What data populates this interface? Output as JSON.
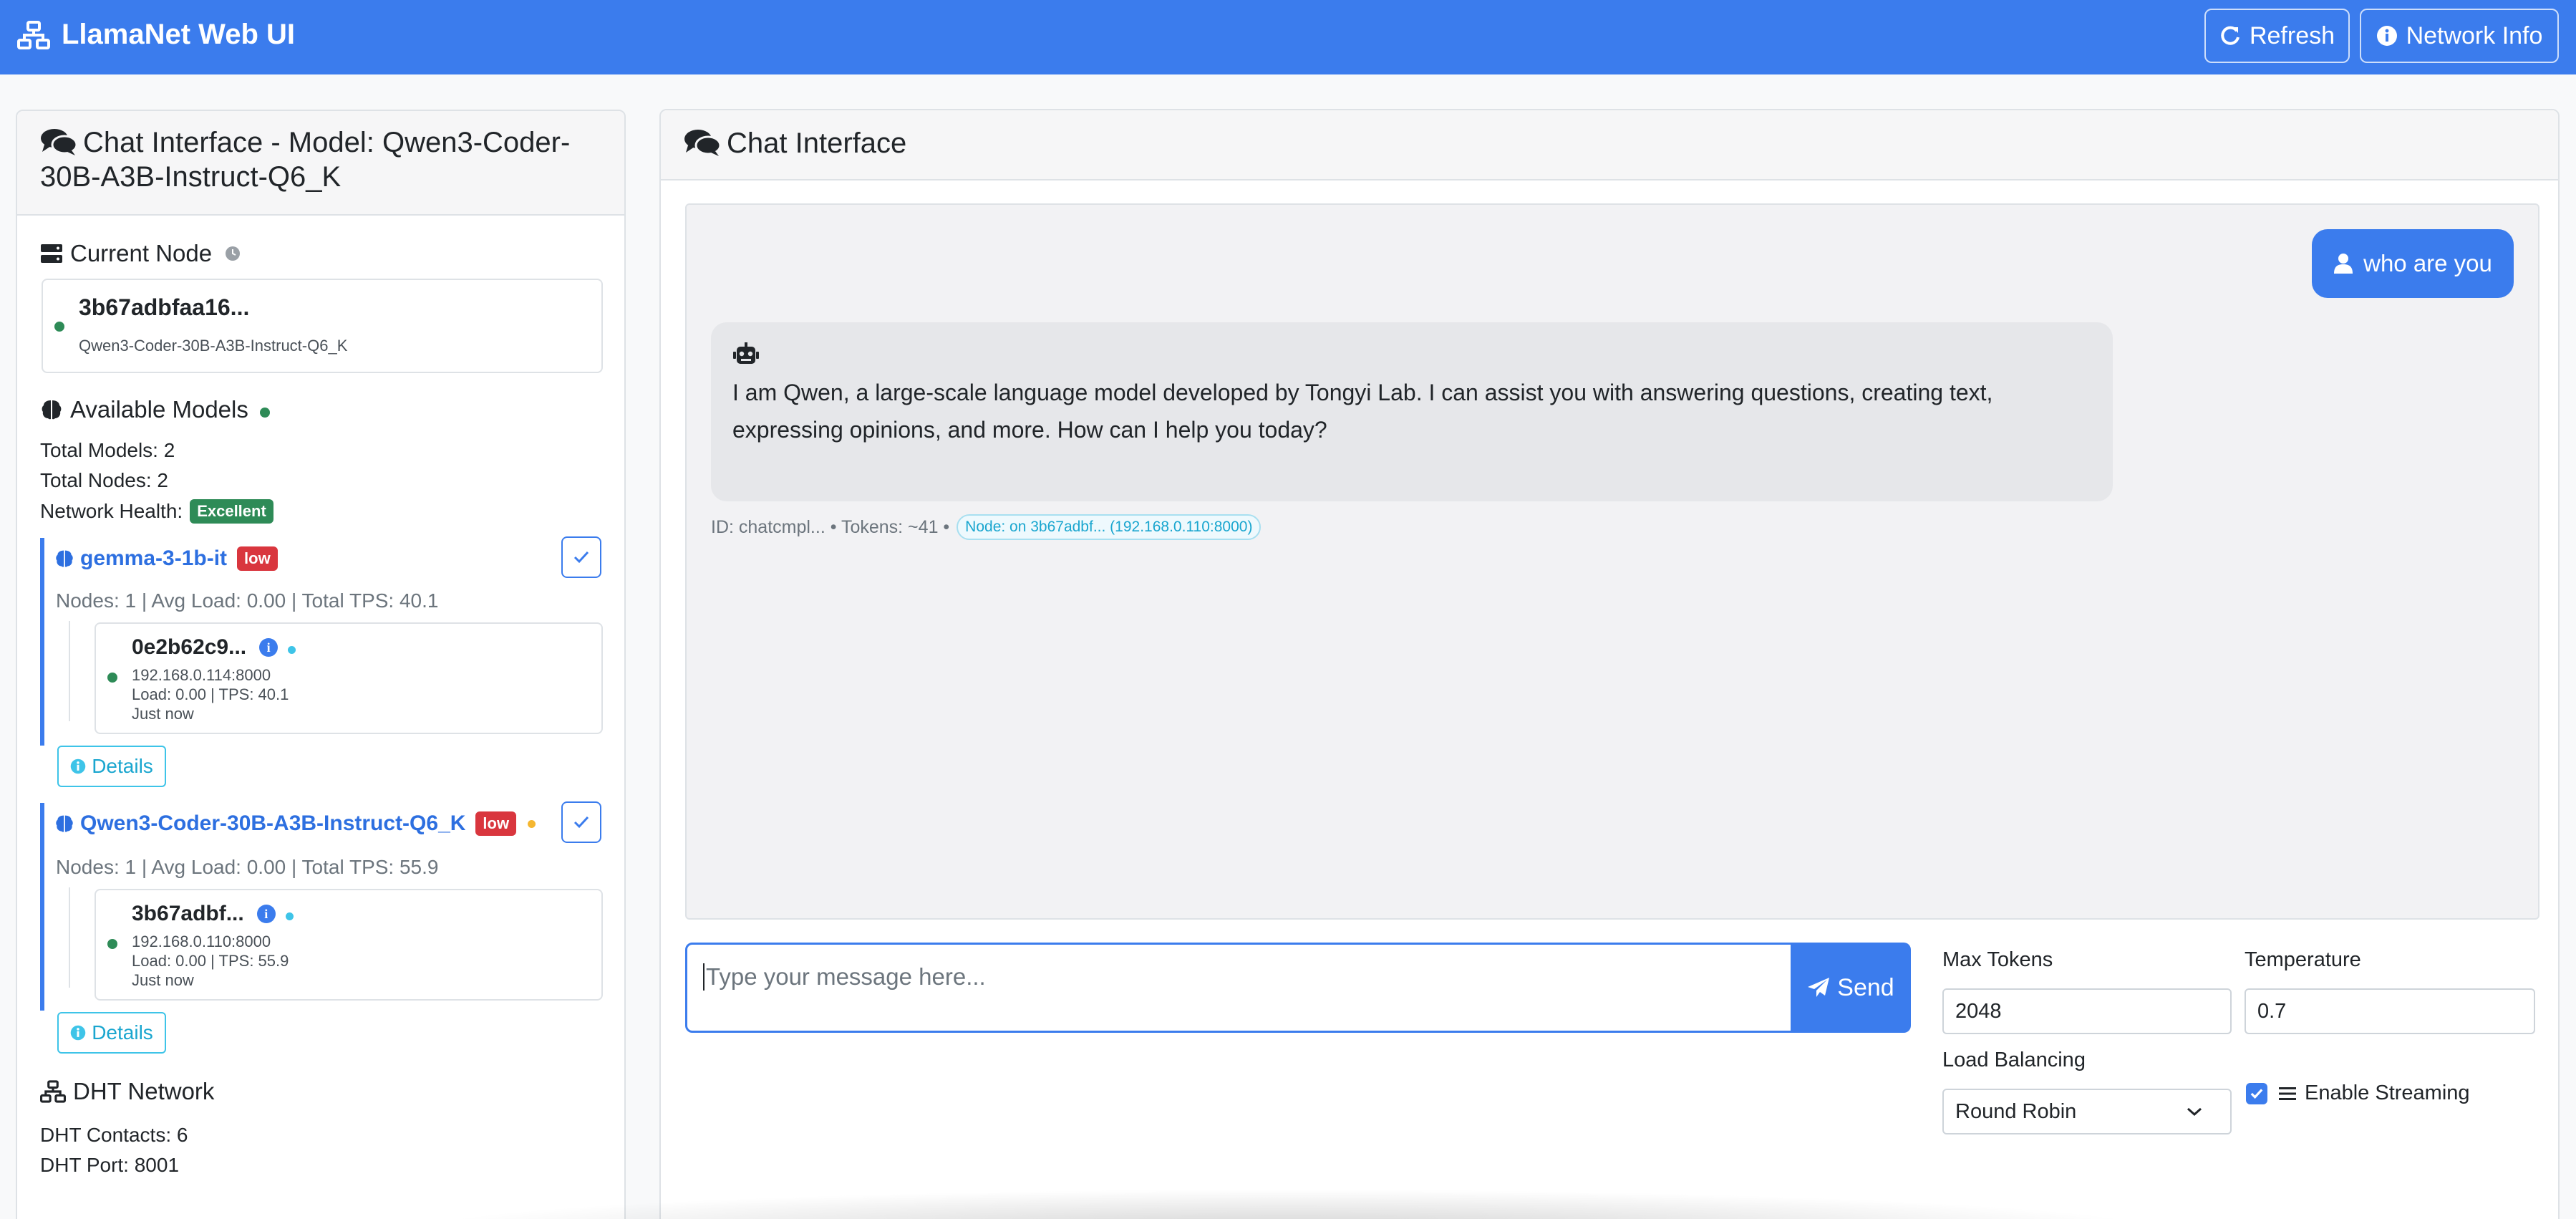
{
  "navbar": {
    "brand": "LlamaNet Web UI",
    "refresh_label": "Refresh",
    "network_info_label": "Network Info"
  },
  "sidebar": {
    "title": "Chat Interface - Model: Qwen3-Coder-30B-A3B-Instruct-Q6_K",
    "current_node": {
      "heading": "Current Node",
      "node_id": "3b67adbfaa16...",
      "model": "Qwen3-Coder-30B-A3B-Instruct-Q6_K"
    },
    "available_models": {
      "heading": "Available Models",
      "total_models": "Total Models: 2",
      "total_nodes": "Total Nodes: 2",
      "network_health_label": "Network Health:",
      "network_health_value": "Excellent"
    },
    "models": [
      {
        "name": "gemma-3-1b-it",
        "badge": "low",
        "stats": "Nodes: 1 | Avg Load: 0.00 | Total TPS: 40.1",
        "node": {
          "id": "0e2b62c9...",
          "address": "192.168.0.114:8000",
          "load": "Load: 0.00 | TPS: 40.1",
          "seen": "Just now"
        },
        "details_label": "Details"
      },
      {
        "name": "Qwen3-Coder-30B-A3B-Instruct-Q6_K",
        "badge": "low",
        "stats": "Nodes: 1 | Avg Load: 0.00 | Total TPS: 55.9",
        "node": {
          "id": "3b67adbf...",
          "address": "192.168.0.110:8000",
          "load": "Load: 0.00 | TPS: 55.9",
          "seen": "Just now"
        },
        "details_label": "Details"
      }
    ],
    "dht": {
      "heading": "DHT Network",
      "contacts": "DHT Contacts: 6",
      "port": "DHT Port: 8001"
    }
  },
  "chat": {
    "title": "Chat Interface",
    "messages": [
      {
        "role": "user",
        "text": "who are you"
      },
      {
        "role": "assistant",
        "text": " I am Qwen, a large-scale language model developed by Tongyi Lab. I can assist you with answering questions, creating text, expressing opinions, and more. How can I help you today?"
      }
    ],
    "meta": "ID: chatcmpl... • Tokens: ~41 •",
    "node_pill": "Node: on 3b67adbf... (192.168.0.110:8000)",
    "input_placeholder": "Type your message here...",
    "send_label": "Send"
  },
  "settings": {
    "max_tokens_label": "Max Tokens",
    "max_tokens_value": "2048",
    "temperature_label": "Temperature",
    "temperature_value": "0.7",
    "load_balancing_label": "Load Balancing",
    "load_balancing_value": "Round Robin",
    "streaming_label": "Enable Streaming",
    "streaming_enabled": true
  },
  "colors": {
    "primary": "#3b7ced",
    "success": "#2e8b57",
    "danger": "#d9363e",
    "info": "#3ec4e8",
    "warning": "#f5b731"
  }
}
